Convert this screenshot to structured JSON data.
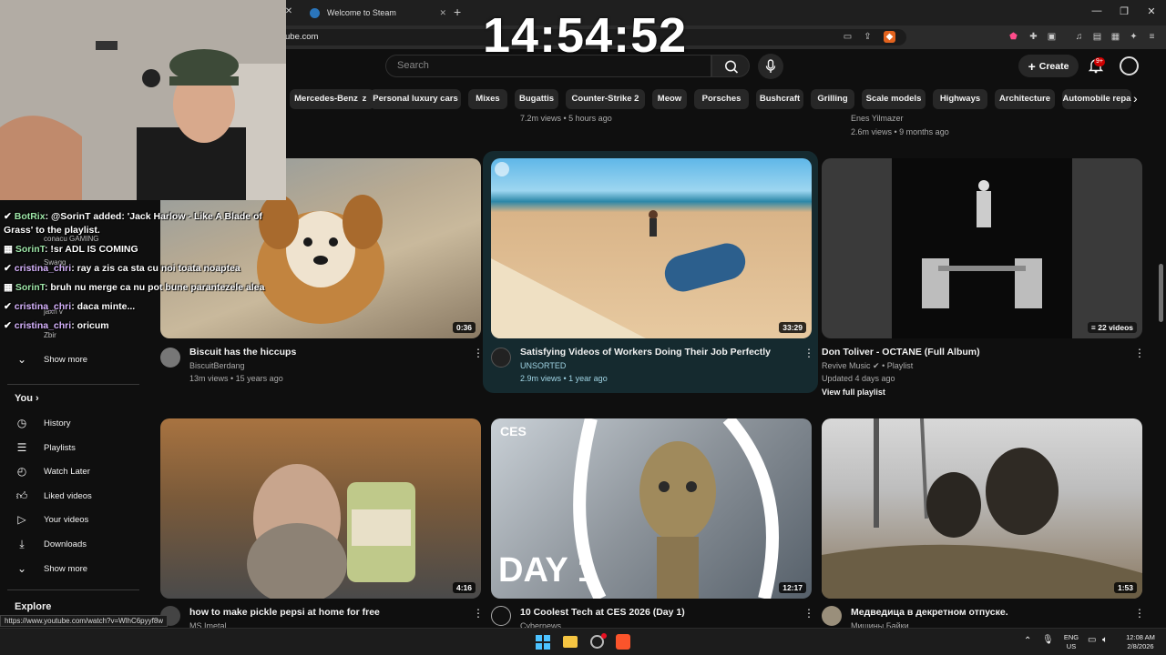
{
  "browser": {
    "tab_title": "Welcome to Steam",
    "url": "ube.com"
  },
  "clock": "14:54:52",
  "youtube": {
    "search_placeholder": "Search",
    "create_label": "Create",
    "notif_count": "9+",
    "chips": [
      "Mercedes-Benz",
      "Personal luxury cars",
      "Mixes",
      "Bugattis",
      "Counter-Strike 2",
      "Meow",
      "Porsches",
      "Bushcraft",
      "Grilling",
      "Scale models",
      "Highways",
      "Architecture",
      "Automobile repa"
    ]
  },
  "top_row": {
    "middle_meta": "7.2m views • 5 hours ago",
    "right_channel": "Enes Yilmazer",
    "right_meta": "2.6m views • 9 months ago"
  },
  "sidebar": {
    "show_more_1": "Show more",
    "you_label": "You",
    "items": [
      {
        "label": "History",
        "icon": "history-icon"
      },
      {
        "label": "Playlists",
        "icon": "playlists-icon"
      },
      {
        "label": "Watch Later",
        "icon": "watch-later-icon"
      },
      {
        "label": "Liked videos",
        "icon": "thumbs-up-icon"
      },
      {
        "label": "Your videos",
        "icon": "play-square-icon"
      },
      {
        "label": "Downloads",
        "icon": "download-icon"
      }
    ],
    "show_more_2": "Show more",
    "explore_label": "Explore",
    "subs": [
      "conacu GAMING",
      "Swagg",
      "jaxn v",
      "Zbir"
    ]
  },
  "chat": [
    {
      "user": "BotRix",
      "text": ": @SorinT added: 'Jack Harlow - Like A Blade of"
    },
    {
      "user": "",
      "text": "Grass' to the playlist."
    },
    {
      "user": "SorinT",
      "text": ": !sr ADL IS COMING"
    },
    {
      "user": "cristina_chri",
      "text": ": ray a zis ca sta cu noi toata noaptea"
    },
    {
      "user": "SorinT",
      "text": ": bruh nu merge ca nu pot bune parantezele alea"
    },
    {
      "user": "cristina_chri",
      "text": ": daca minte..."
    },
    {
      "user": "cristina_chri",
      "text": ": oricum"
    }
  ],
  "videos": [
    {
      "title": "Biscuit has the hiccups",
      "channel": "BiscuitBerdang",
      "meta": "13m views • 15 years ago",
      "duration": "0:36"
    },
    {
      "title": "Satisfying Videos of Workers Doing Their Job Perfectly",
      "channel": "UNSORTED",
      "meta": "2.9m views • 1 year ago",
      "duration": "33:29"
    },
    {
      "title": "Don Toliver - OCTANE (Full Album)",
      "channel": "Revive Music",
      "channel_suffix": "• Playlist",
      "meta": "Updated 4 days ago",
      "extra": "View full playlist",
      "duration": "22 videos"
    },
    {
      "title": "how to make pickle  pepsi at home  for free",
      "channel": "MS Imetal",
      "duration": "4:16"
    },
    {
      "title": "10 Coolest Tech at CES 2026 (Day 1)",
      "channel": "Cybernews",
      "duration": "12:17",
      "thumb_text_1": "CES",
      "thumb_text_2": "DAY 1"
    },
    {
      "title": "Медведица в декретном отпуске.",
      "channel": "Мишины Байки",
      "duration": "1:53"
    }
  ],
  "status_url": "https://www.youtube.com/watch?v=WlhC6pyyf8w",
  "tray": {
    "lang_1": "ENG",
    "lang_2": "US",
    "time": "12:08 AM",
    "date": "2/8/2026"
  }
}
